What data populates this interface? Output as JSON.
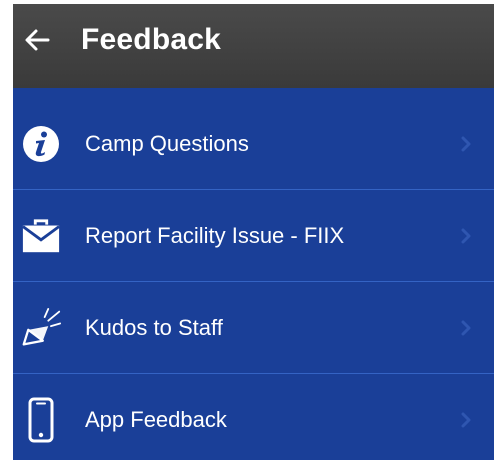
{
  "header": {
    "title": "Feedback",
    "back_icon": "arrow-left-icon"
  },
  "menu": {
    "items": [
      {
        "label": "Camp Questions",
        "icon": "info-icon"
      },
      {
        "label": "Report Facility Issue - FIIX",
        "icon": "envelope-icon"
      },
      {
        "label": "Kudos to Staff",
        "icon": "megaphone-icon"
      },
      {
        "label": "App Feedback",
        "icon": "smartphone-icon"
      }
    ],
    "chevron_icon": "chevron-right-icon"
  },
  "colors": {
    "header_bg": "#414141",
    "list_bg": "#1a3f98",
    "divider": "#3463c4",
    "text": "#ffffff",
    "chevron": "#2f56b0"
  }
}
